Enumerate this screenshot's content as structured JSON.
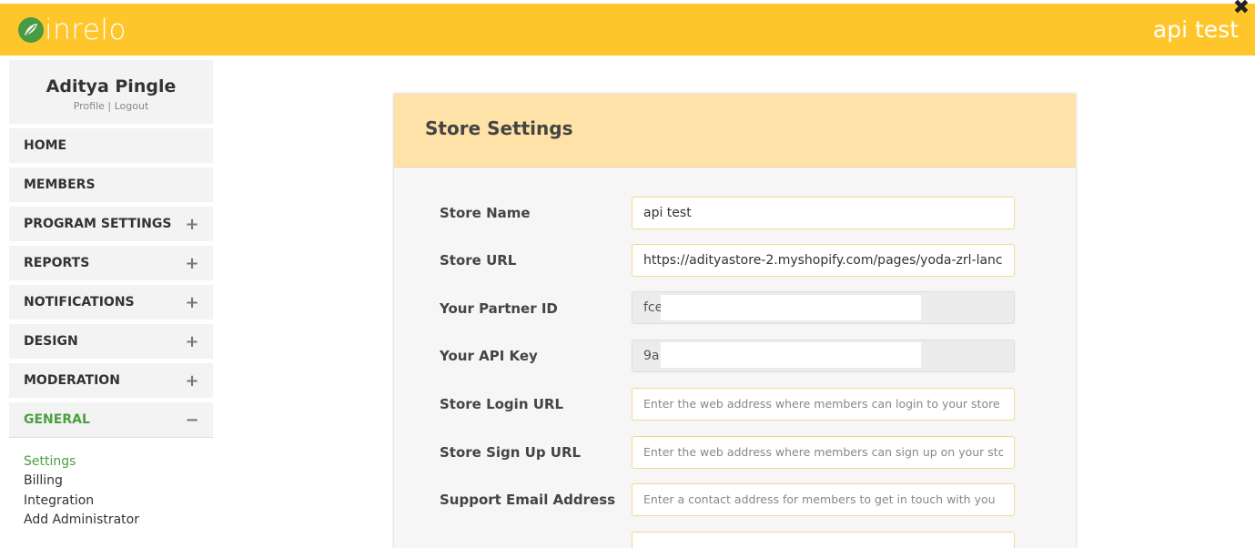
{
  "header": {
    "logo_text": "inrelo",
    "store_title": "api test",
    "brand_color": "#ffc62b",
    "close_icon": "close-icon"
  },
  "user": {
    "name": "Aditya Pingle",
    "profile_link": "Profile",
    "separator": "|",
    "logout_link": "Logout"
  },
  "sidebar": {
    "items": [
      {
        "label": "HOME",
        "toggle": ""
      },
      {
        "label": "MEMBERS",
        "toggle": ""
      },
      {
        "label": "PROGRAM SETTINGS",
        "toggle": "+"
      },
      {
        "label": "REPORTS",
        "toggle": "+"
      },
      {
        "label": "NOTIFICATIONS",
        "toggle": "+"
      },
      {
        "label": "DESIGN",
        "toggle": "+"
      },
      {
        "label": "MODERATION",
        "toggle": "+"
      },
      {
        "label": "GENERAL",
        "toggle": "−"
      }
    ],
    "sub_items": [
      "Settings",
      "Billing",
      "Integration",
      "Add Administrator"
    ],
    "active_color": "#4aa040"
  },
  "panel": {
    "title": "Store Settings",
    "fields": [
      {
        "label": "Store Name",
        "value": "api test",
        "placeholder": ""
      },
      {
        "label": "Store URL",
        "value": "https://adityastore-2.myshopify.com/pages/yoda-zrl-lanc",
        "placeholder": ""
      },
      {
        "label": "Your Partner ID",
        "value": "fce",
        "placeholder": ""
      },
      {
        "label": "Your API Key",
        "value": "9a",
        "placeholder": ""
      },
      {
        "label": "Store Login URL",
        "value": "",
        "placeholder": "Enter the web address where members can login to your store"
      },
      {
        "label": "Store Sign Up URL",
        "value": "",
        "placeholder": "Enter the web address where members can sign up on your store"
      },
      {
        "label": "Support Email Address",
        "value": "",
        "placeholder": "Enter a contact address for members to get in touch with you"
      }
    ]
  }
}
